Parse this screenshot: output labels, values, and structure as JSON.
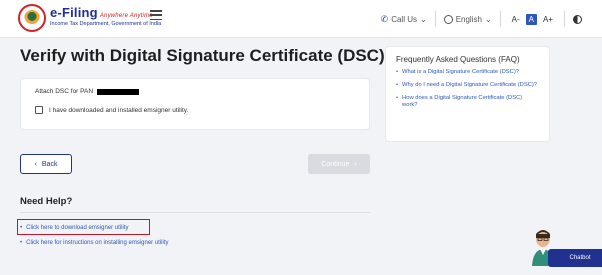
{
  "header": {
    "logo_title": "e-Filing",
    "logo_tagline": "Anywhere Anytime",
    "logo_subtitle": "Income Tax Department, Government of India",
    "call_us": "Call Us",
    "language": "English",
    "font_decrease": "A-",
    "font_normal": "A",
    "font_increase": "A+"
  },
  "main": {
    "title": "Verify with Digital Signature Certificate (DSC)",
    "attach_label": "Attach DSC for PAN",
    "checkbox_label": "I have downloaded and installed emsigner utility.",
    "back_label": "Back",
    "continue_label": "Continue"
  },
  "help": {
    "heading": "Need Help?",
    "links": [
      "Click here to download emsigner utility",
      "Click here for instructions on installing emsigner utility"
    ]
  },
  "faq": {
    "title": "Frequently Asked Questions (FAQ)",
    "items": [
      "What is a Digital Signature Certificate (DSC)?",
      "Why do I need a Digital Signature Certificate (DSC)?",
      "How does a Digital Signature Certificate (DSC) work?"
    ]
  },
  "chatbot": {
    "label": "Chatbot"
  },
  "colors": {
    "brand_blue": "#21318f",
    "link_blue": "#2c58b8",
    "highlight_red": "#c0172a"
  }
}
